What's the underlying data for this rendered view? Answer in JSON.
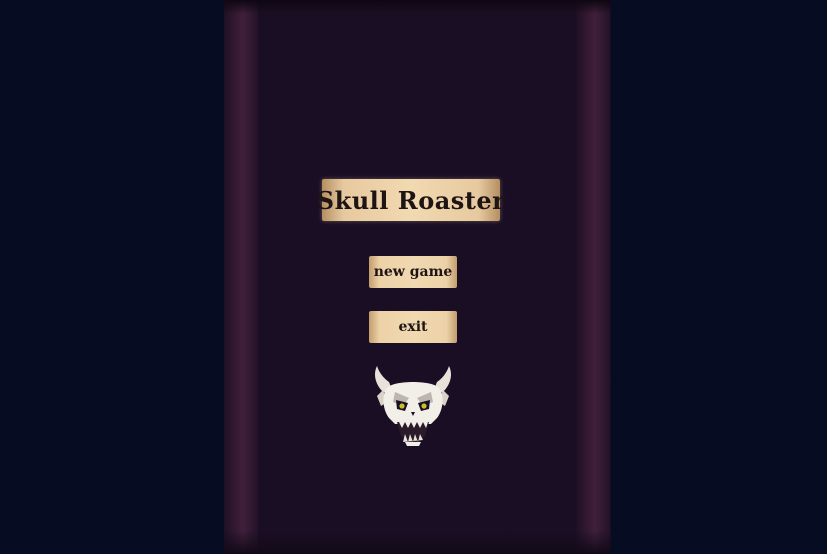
{
  "title": "Skull Roaster",
  "menu": {
    "new_game_label": "new game",
    "exit_label": "exit"
  },
  "icons": {
    "mascot": "horned-skull-icon"
  },
  "colors": {
    "background": "#070d22",
    "column": "#1a0e24",
    "pillar": "#3a1c36",
    "parchment": "#f0d8b0",
    "ink": "#1e1414",
    "skull_eyes": "#c8c020"
  }
}
